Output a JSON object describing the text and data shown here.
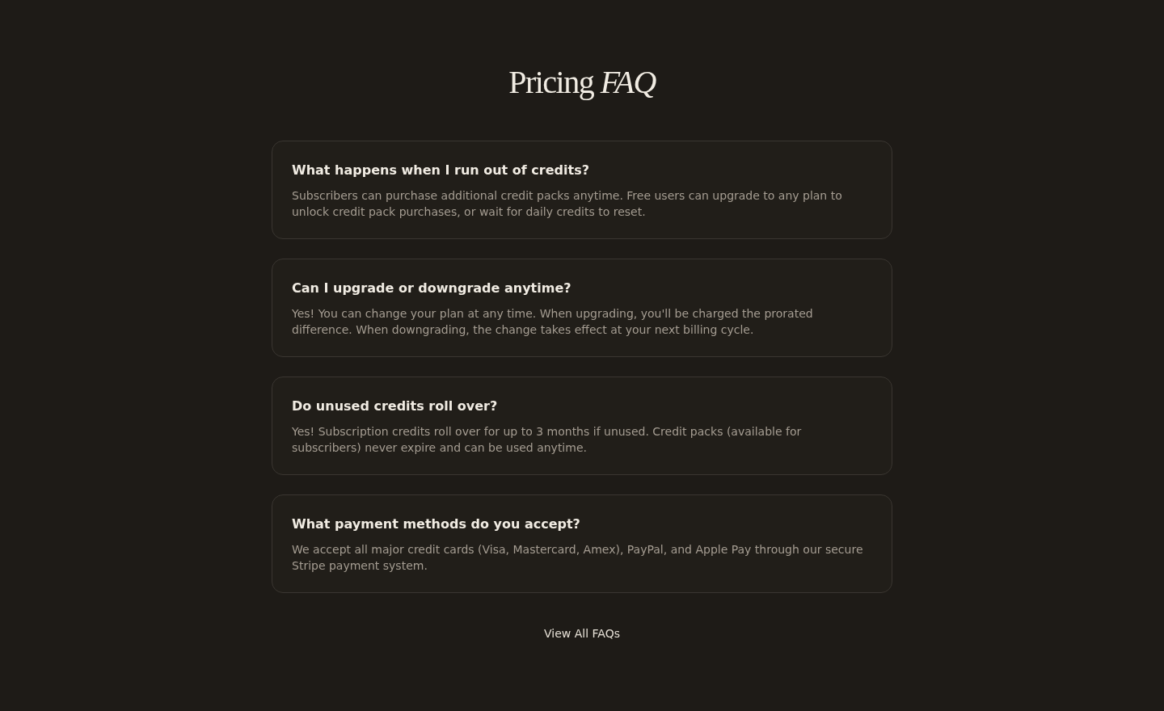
{
  "heading": "Pricing *FAQ*",
  "faqs": [
    {
      "question": "What happens when I run out of credits?",
      "answer": "Subscribers can purchase additional credit packs anytime. Free users can upgrade to any plan to unlock credit pack purchases, or wait for daily credits to reset."
    },
    {
      "question": "Can I upgrade or downgrade anytime?",
      "answer": "Yes! You can change your plan at any time. When upgrading, you'll be charged the prorated difference. When downgrading, the change takes effect at your next billing cycle."
    },
    {
      "question": "Do unused credits roll over?",
      "answer": "Yes! Subscription credits roll over for up to 3 months if unused. Credit packs (available for subscribers) never expire and can be used anytime."
    },
    {
      "question": "What payment methods do you accept?",
      "answer": "We accept all major credit cards (Visa, Mastercard, Amex), PayPal, and Apple Pay through our secure Stripe payment system."
    }
  ],
  "view_all_link": "View All FAQs"
}
